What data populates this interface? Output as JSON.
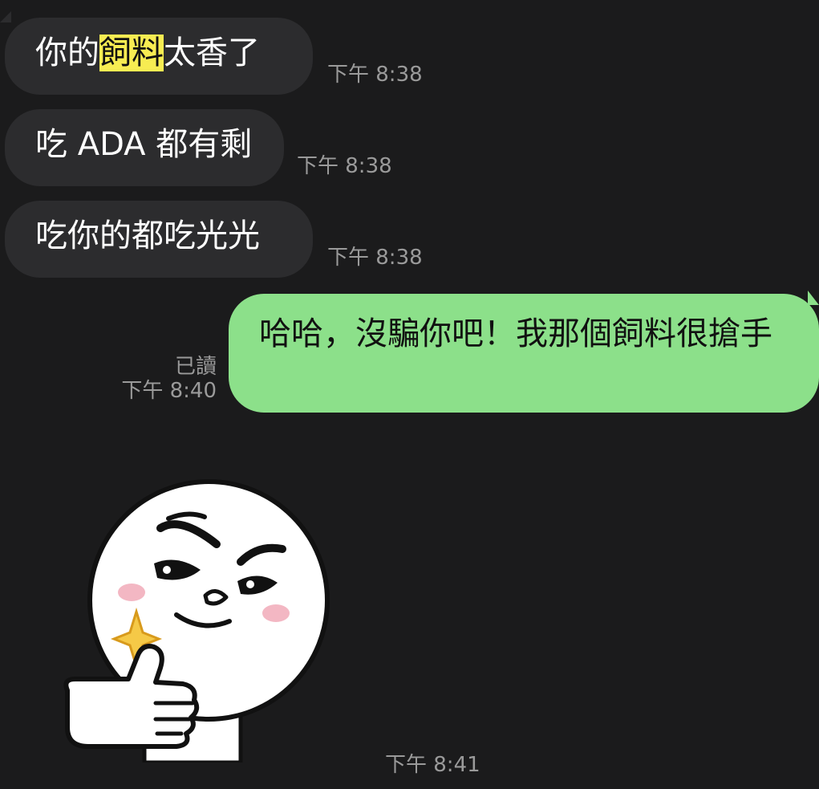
{
  "messages": [
    {
      "direction": "in",
      "parts": [
        {
          "text": "你的",
          "highlight": false
        },
        {
          "text": "飼料",
          "highlight": true
        },
        {
          "text": "太香了",
          "highlight": false
        }
      ],
      "time": "下午 8:38"
    },
    {
      "direction": "in",
      "text": "吃 ADA 都有剩",
      "time": "下午 8:38"
    },
    {
      "direction": "in",
      "text": "吃你的都吃光光",
      "time": "下午 8:38"
    },
    {
      "direction": "out",
      "text": "哈哈，沒騙你吧！我那個飼料很搶手",
      "read_status": "已讀",
      "time": "下午 8:40"
    },
    {
      "direction": "in",
      "type": "sticker",
      "sticker_icon": "moon-thumbs-up-sticker-icon",
      "time": "下午 8:41"
    }
  ],
  "colors": {
    "background": "#1b1b1c",
    "incoming_bubble": "#2c2c2e",
    "outgoing_bubble": "#8ce08a",
    "highlight": "#f7ec52",
    "timestamp": "#9a9a9a"
  }
}
